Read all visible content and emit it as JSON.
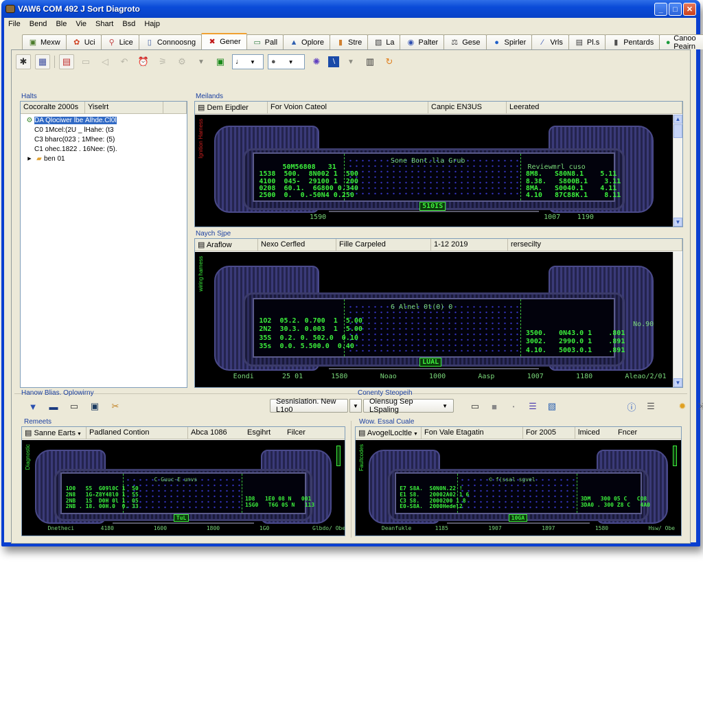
{
  "window": {
    "title": "VAW6 COM 492 J Sort Diagroto",
    "controls": {
      "minimize": "_",
      "maximize": "□",
      "close": "✕"
    }
  },
  "menu": [
    "File",
    "Bend",
    "Ble",
    "Vie",
    "Shart",
    "Bsd",
    "Hajp"
  ],
  "tabs": [
    {
      "label": "Mexw",
      "icon": "modem-icon",
      "glyph": "▣",
      "color": "#4a7a2a"
    },
    {
      "label": "Uci",
      "icon": "flower-icon",
      "glyph": "✿",
      "color": "#d04020"
    },
    {
      "label": "Lice",
      "icon": "pin-icon",
      "glyph": "⚲",
      "color": "#c04040"
    },
    {
      "label": "Connoosng",
      "icon": "device-icon",
      "glyph": "▯",
      "color": "#4060a0"
    },
    {
      "label": "Gener",
      "icon": "x-mark-icon",
      "glyph": "✖",
      "color": "#c01818",
      "active": true
    },
    {
      "label": "Pall",
      "icon": "monitor-icon",
      "glyph": "▭",
      "color": "#2a7a3a"
    },
    {
      "label": "Oplore",
      "icon": "cap-icon",
      "glyph": "▲",
      "color": "#3060b0"
    },
    {
      "label": "Stre",
      "icon": "book-icon",
      "glyph": "▮",
      "color": "#d08030"
    },
    {
      "label": "La",
      "icon": "image-icon",
      "glyph": "▧",
      "color": "#404040"
    },
    {
      "label": "Palter",
      "icon": "badge-icon",
      "glyph": "◉",
      "color": "#3050b0"
    },
    {
      "label": "Gese",
      "icon": "scale-icon",
      "glyph": "⚖",
      "color": "#404040"
    },
    {
      "label": "Spirler",
      "icon": "globe-icon",
      "glyph": "●",
      "color": "#1f5fc8"
    },
    {
      "label": "Vrls",
      "icon": "pen-icon",
      "glyph": "∕",
      "color": "#3050b0"
    },
    {
      "label": "Pl.s",
      "icon": "chart-icon",
      "glyph": "▤",
      "color": "#404040"
    },
    {
      "label": "Pentards",
      "icon": "trash-icon",
      "glyph": "▮",
      "color": "#505050"
    },
    {
      "label": "Canoo Peairn",
      "icon": "green-circle-icon",
      "glyph": "●",
      "color": "#1a9a3a"
    }
  ],
  "toolbar": {
    "combo1_value": "♩",
    "combo2_value": "●"
  },
  "left_panel": {
    "group_label": "Halts",
    "columns": [
      "Cocoralte 2000s",
      "Yiselrt",
      ""
    ],
    "rows": [
      {
        "col1": "DA Qlociwer lbe",
        "col2": "Alhde.Cl0l",
        "selected": true,
        "icon": "car-icon"
      },
      {
        "col1": "C0 1Mcel:(2U _",
        "col2": "lHahe: (t3",
        "selected": false
      },
      {
        "col1": "C3 bharc(023 ;",
        "col2": "1Mhee: (5)",
        "selected": false
      },
      {
        "col1": "C1 ohec.1822 .",
        "col2": "16Nee: (5).",
        "selected": false
      },
      {
        "col1": "ben 01",
        "col2": "",
        "folder": true
      }
    ]
  },
  "panel_top": {
    "group_label": "Meilands",
    "columns": [
      "Dem Eipdler",
      "For Voion Cateol",
      "Canpic EN3US",
      "Leerated"
    ],
    "display": {
      "center_title": "Sone Bont.lla Grub",
      "left_title": "50M56808   31",
      "left_rows": [
        "1538  500.  8N002 1  500",
        "4100  045-  29100 1  200",
        "0208  60.1.  6G800 0.340",
        "2500  0.  0.-50N4 0.250"
      ],
      "right_title": "Reviewmrl cuso",
      "right_rows": [
        "8M8.   S80N8.1    5.11",
        "8.38.   S800B.1    3.11",
        "8MA.   S0040.1    4.11",
        "4.10   87C88K.1    8.11"
      ],
      "badge": "510IS",
      "footer_left": "1590",
      "footer_mid": "1007",
      "footer_right": "1190",
      "side_label": "Ignition Harness"
    }
  },
  "panel_mid": {
    "group_label": "Naych Sjpe",
    "columns": [
      "Araflow",
      "Nexo Cerfled",
      "Fille Carpeled",
      "1-12 2019",
      "rersecilty"
    ],
    "display": {
      "center_title": "6 Alnel 0t(0) 0",
      "left_rows": [
        "1O2  05.2. 0.700  1  5.00",
        "2N2  30.3. 0.003  1  5.00",
        "35S  0.2. 0. 502.0  0.10",
        "35s  0.0. 5.500.0  0.40"
      ],
      "right_rows": [
        "3500.   0N43.0 1    .801",
        "3002.   2990.0 1    .891",
        "4.10.   5003.0.1    .891"
      ],
      "badge": "LUAL",
      "footer_items": [
        "Eondi",
        "25 01",
        "1580",
        "Noao",
        "1000",
        "Aasp",
        "1007",
        "1180",
        "Aleao/2/01"
      ],
      "side_label": "wiring harness",
      "right_side_label": "No.90"
    }
  },
  "lower_toolbar": {
    "group_label": "Hanow Blias. Oplowirny",
    "right_group_label": "Conenty Steopeih",
    "combo1_value": "Sesnisiation. New L1o0",
    "combo2_value": "Oiensug Sep LSpaling"
  },
  "panel_bl": {
    "group_label": "Remeets",
    "columns": [
      "Sanne Earts",
      "Padlaned Contion",
      "Abca 1086",
      "Esgihrt",
      "Filcer"
    ],
    "display": {
      "center_title": "C Guuc-E unvs",
      "left_rows": [
        "1O0   S5  G09l0C 1  50",
        "2N8   1G-Z8Y48l0 1  55",
        "2NB   1S  D0H 0l 1  05",
        "2NB . 18. 00H.0  0. 33"
      ],
      "right_rows": [
        "1D8   1E0 08 N   001",
        "1SG0   T6G 0S N   113"
      ],
      "badge": "TuL",
      "footer_items": [
        "Dnetheci",
        "4180",
        "1600",
        "1800",
        "1G0",
        "Glbdo/ Obe"
      ],
      "side_label": "Diagnostic"
    }
  },
  "panel_br": {
    "group_label": "Wow. Essal Cuale",
    "columns": [
      "AvogelLocltle",
      "Fon Vale Etagatin",
      "For 2005",
      "lmiced",
      "Fncer"
    ],
    "display": {
      "center_title": "© f(ssal sgvel",
      "left_rows": [
        "E7 S8A.  S0N0N.22 !",
        "E1 S8.   20002A02 1 6",
        "C3 S8.   2000200 1 8",
        "E0-S8A.  2000Hedel2"
      ],
      "right_rows": [
        "3DM   300 05 C   CO8",
        "3DA0 . 300 Z8 C   4A0"
      ],
      "badge": "10GA",
      "footer_items": [
        "Deanfukle",
        "1185",
        "1907",
        "1897",
        "1580",
        "Hsw/ Obe"
      ],
      "side_label": "Faultcodes"
    }
  }
}
